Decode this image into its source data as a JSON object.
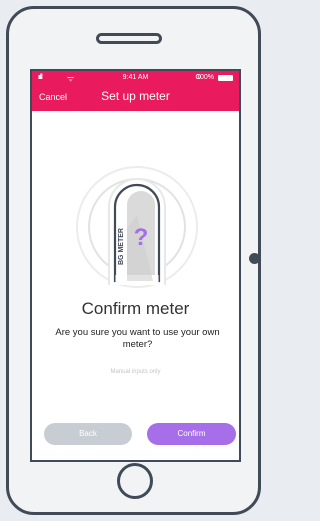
{
  "status_bar": {
    "signal": "ııll",
    "wifi": "ᯤ",
    "time": "9:41 AM",
    "bluetooth": "ʘ",
    "battery": "100%"
  },
  "nav": {
    "cancel": "Cancel",
    "title": "Set up meter"
  },
  "illustration": {
    "meter_label": "BG METER",
    "symbol": "?"
  },
  "content": {
    "title": "Confirm meter",
    "question": "Are you sure you want to use your own meter?",
    "note": "Manual inputs only"
  },
  "buttons": {
    "back": "Back",
    "confirm": "Confirm"
  },
  "colors": {
    "header": "#e91b5e",
    "confirm": "#a66ee8",
    "back": "#c7cdd2",
    "frame": "#414b57"
  }
}
